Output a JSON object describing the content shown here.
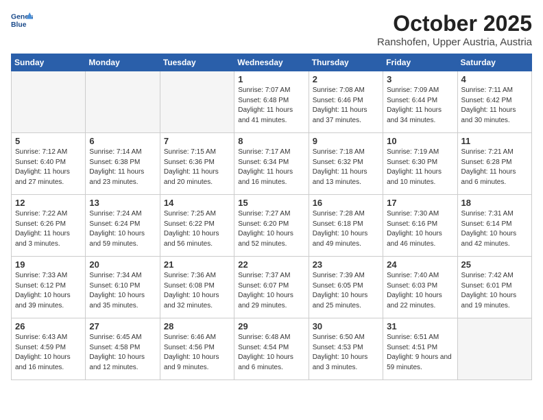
{
  "header": {
    "logo_line1": "General",
    "logo_line2": "Blue",
    "month": "October 2025",
    "location": "Ranshofen, Upper Austria, Austria"
  },
  "weekdays": [
    "Sunday",
    "Monday",
    "Tuesday",
    "Wednesday",
    "Thursday",
    "Friday",
    "Saturday"
  ],
  "weeks": [
    [
      {
        "day": "",
        "sunrise": "",
        "sunset": "",
        "daylight": ""
      },
      {
        "day": "",
        "sunrise": "",
        "sunset": "",
        "daylight": ""
      },
      {
        "day": "",
        "sunrise": "",
        "sunset": "",
        "daylight": ""
      },
      {
        "day": "1",
        "sunrise": "7:07 AM",
        "sunset": "6:48 PM",
        "daylight": "11 hours and 41 minutes."
      },
      {
        "day": "2",
        "sunrise": "7:08 AM",
        "sunset": "6:46 PM",
        "daylight": "11 hours and 37 minutes."
      },
      {
        "day": "3",
        "sunrise": "7:09 AM",
        "sunset": "6:44 PM",
        "daylight": "11 hours and 34 minutes."
      },
      {
        "day": "4",
        "sunrise": "7:11 AM",
        "sunset": "6:42 PM",
        "daylight": "11 hours and 30 minutes."
      }
    ],
    [
      {
        "day": "5",
        "sunrise": "7:12 AM",
        "sunset": "6:40 PM",
        "daylight": "11 hours and 27 minutes."
      },
      {
        "day": "6",
        "sunrise": "7:14 AM",
        "sunset": "6:38 PM",
        "daylight": "11 hours and 23 minutes."
      },
      {
        "day": "7",
        "sunrise": "7:15 AM",
        "sunset": "6:36 PM",
        "daylight": "11 hours and 20 minutes."
      },
      {
        "day": "8",
        "sunrise": "7:17 AM",
        "sunset": "6:34 PM",
        "daylight": "11 hours and 16 minutes."
      },
      {
        "day": "9",
        "sunrise": "7:18 AM",
        "sunset": "6:32 PM",
        "daylight": "11 hours and 13 minutes."
      },
      {
        "day": "10",
        "sunrise": "7:19 AM",
        "sunset": "6:30 PM",
        "daylight": "11 hours and 10 minutes."
      },
      {
        "day": "11",
        "sunrise": "7:21 AM",
        "sunset": "6:28 PM",
        "daylight": "11 hours and 6 minutes."
      }
    ],
    [
      {
        "day": "12",
        "sunrise": "7:22 AM",
        "sunset": "6:26 PM",
        "daylight": "11 hours and 3 minutes."
      },
      {
        "day": "13",
        "sunrise": "7:24 AM",
        "sunset": "6:24 PM",
        "daylight": "10 hours and 59 minutes."
      },
      {
        "day": "14",
        "sunrise": "7:25 AM",
        "sunset": "6:22 PM",
        "daylight": "10 hours and 56 minutes."
      },
      {
        "day": "15",
        "sunrise": "7:27 AM",
        "sunset": "6:20 PM",
        "daylight": "10 hours and 52 minutes."
      },
      {
        "day": "16",
        "sunrise": "7:28 AM",
        "sunset": "6:18 PM",
        "daylight": "10 hours and 49 minutes."
      },
      {
        "day": "17",
        "sunrise": "7:30 AM",
        "sunset": "6:16 PM",
        "daylight": "10 hours and 46 minutes."
      },
      {
        "day": "18",
        "sunrise": "7:31 AM",
        "sunset": "6:14 PM",
        "daylight": "10 hours and 42 minutes."
      }
    ],
    [
      {
        "day": "19",
        "sunrise": "7:33 AM",
        "sunset": "6:12 PM",
        "daylight": "10 hours and 39 minutes."
      },
      {
        "day": "20",
        "sunrise": "7:34 AM",
        "sunset": "6:10 PM",
        "daylight": "10 hours and 35 minutes."
      },
      {
        "day": "21",
        "sunrise": "7:36 AM",
        "sunset": "6:08 PM",
        "daylight": "10 hours and 32 minutes."
      },
      {
        "day": "22",
        "sunrise": "7:37 AM",
        "sunset": "6:07 PM",
        "daylight": "10 hours and 29 minutes."
      },
      {
        "day": "23",
        "sunrise": "7:39 AM",
        "sunset": "6:05 PM",
        "daylight": "10 hours and 25 minutes."
      },
      {
        "day": "24",
        "sunrise": "7:40 AM",
        "sunset": "6:03 PM",
        "daylight": "10 hours and 22 minutes."
      },
      {
        "day": "25",
        "sunrise": "7:42 AM",
        "sunset": "6:01 PM",
        "daylight": "10 hours and 19 minutes."
      }
    ],
    [
      {
        "day": "26",
        "sunrise": "6:43 AM",
        "sunset": "4:59 PM",
        "daylight": "10 hours and 16 minutes."
      },
      {
        "day": "27",
        "sunrise": "6:45 AM",
        "sunset": "4:58 PM",
        "daylight": "10 hours and 12 minutes."
      },
      {
        "day": "28",
        "sunrise": "6:46 AM",
        "sunset": "4:56 PM",
        "daylight": "10 hours and 9 minutes."
      },
      {
        "day": "29",
        "sunrise": "6:48 AM",
        "sunset": "4:54 PM",
        "daylight": "10 hours and 6 minutes."
      },
      {
        "day": "30",
        "sunrise": "6:50 AM",
        "sunset": "4:53 PM",
        "daylight": "10 hours and 3 minutes."
      },
      {
        "day": "31",
        "sunrise": "6:51 AM",
        "sunset": "4:51 PM",
        "daylight": "9 hours and 59 minutes."
      },
      {
        "day": "",
        "sunrise": "",
        "sunset": "",
        "daylight": ""
      }
    ]
  ]
}
